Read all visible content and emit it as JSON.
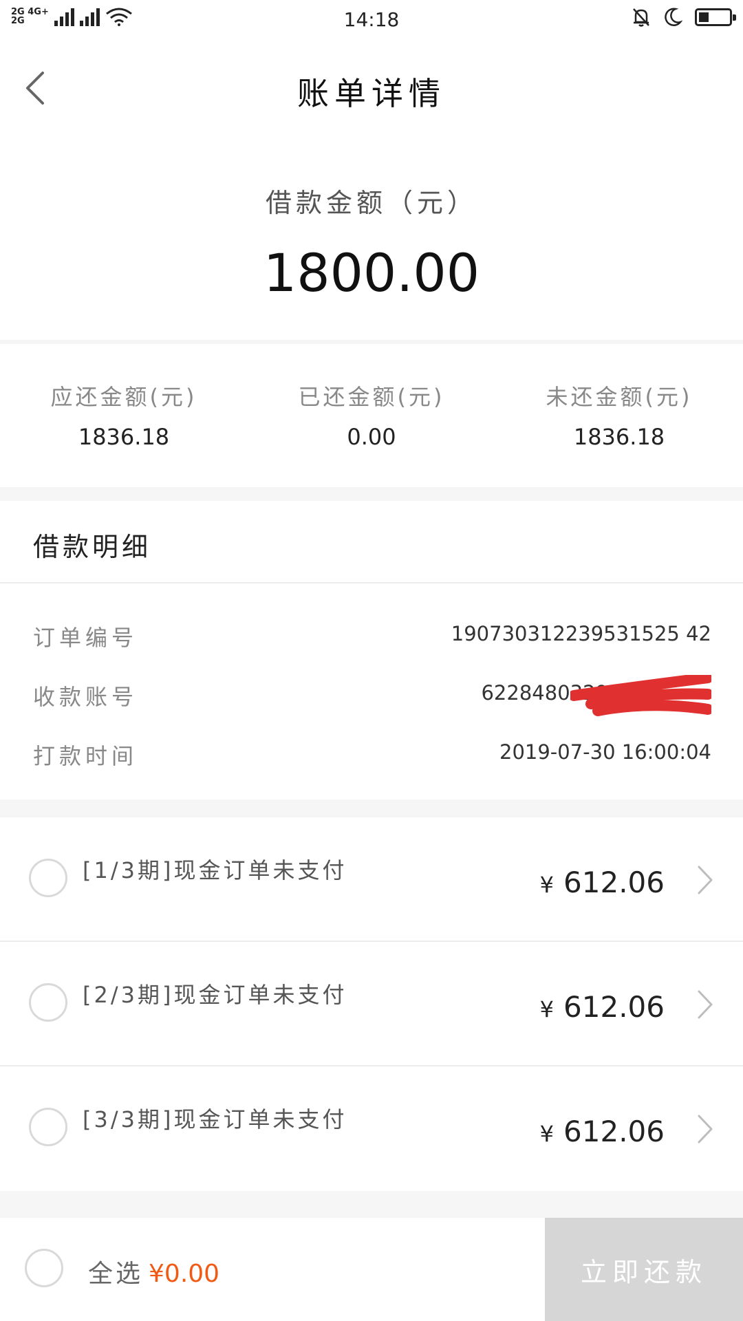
{
  "status_bar": {
    "net_top": "2G 4G+",
    "net_bottom": "2G",
    "time": "14:18"
  },
  "header": {
    "title": "账单详情",
    "back_icon": "chevron-left-icon"
  },
  "loan": {
    "label": "借款金额（元）",
    "value": "1800.00"
  },
  "summary": [
    {
      "label": "应还金额(元)",
      "value": "1836.18"
    },
    {
      "label": "已还金额(元)",
      "value": "0.00"
    },
    {
      "label": "未还金额(元)",
      "value": "1836.18"
    }
  ],
  "details": {
    "title": "借款明细",
    "rows": [
      {
        "key": "订单编号",
        "value": "190730312239531525 42"
      },
      {
        "key": "收款账号",
        "value": "6228480329"
      },
      {
        "key": "打款时间",
        "value": "2019-07-30 16:00:04"
      }
    ]
  },
  "installments": [
    {
      "label": "[1/3期]现金订单未支付",
      "currency": "¥",
      "amount": "612.06"
    },
    {
      "label": "[2/3期]现金订单未支付",
      "currency": "¥",
      "amount": "612.06"
    },
    {
      "label": "[3/3期]现金订单未支付",
      "currency": "¥",
      "amount": "612.06"
    }
  ],
  "bottom_bar": {
    "select_all": "全选",
    "selected_amount": "¥0.00",
    "pay_button": "立即还款"
  },
  "colors": {
    "accent_orange": "#f05a14",
    "disabled_button": "#d6d6d6",
    "redaction_red": "#e03030"
  }
}
